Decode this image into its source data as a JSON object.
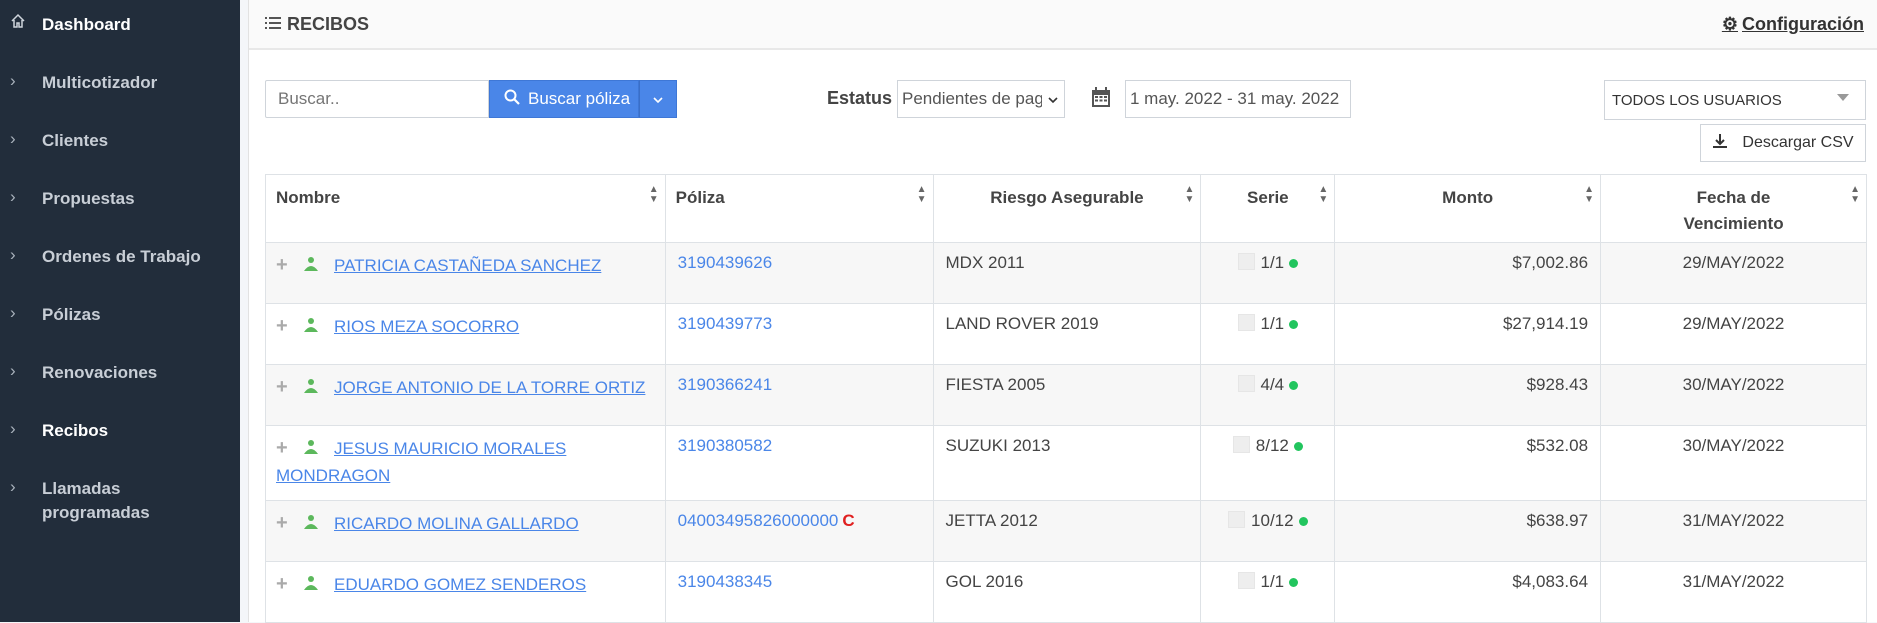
{
  "sidebar": {
    "items": [
      {
        "label": "Dashboard",
        "icon": "home-icon"
      },
      {
        "label": "Multicotizador",
        "icon": "chevron-right-icon"
      },
      {
        "label": "Clientes",
        "icon": "chevron-right-icon"
      },
      {
        "label": "Propuestas",
        "icon": "chevron-right-icon"
      },
      {
        "label": "Ordenes de Trabajo",
        "icon": "chevron-right-icon"
      },
      {
        "label": "Pólizas",
        "icon": "chevron-right-icon"
      },
      {
        "label": "Renovaciones",
        "icon": "chevron-right-icon"
      },
      {
        "label": "Recibos",
        "icon": "chevron-right-icon"
      },
      {
        "label": "Llamadas programadas",
        "icon": "chevron-right-icon"
      }
    ]
  },
  "header": {
    "title": "RECIBOS",
    "config_label": "Configuración"
  },
  "toolbar": {
    "search_placeholder": "Buscar..",
    "search_button": "Buscar póliza",
    "estatus_label": "Estatus",
    "estatus_value": "Pendientes de pago",
    "date_range": "1 may. 2022 - 31 may. 2022",
    "users_value": "TODOS LOS USUARIOS",
    "csv_button": "Descargar CSV"
  },
  "table": {
    "headers": {
      "nombre": "Nombre",
      "poliza": "Póliza",
      "riesgo": "Riesgo Asegurable",
      "serie": "Serie",
      "monto": "Monto",
      "fecha": "Fecha de Vencimiento"
    },
    "rows": [
      {
        "nombre": "PATRICIA CASTAÑEDA SANCHEZ",
        "poliza": "3190439626",
        "badge": "",
        "riesgo": "MDX 2011",
        "serie": "1/1",
        "monto": "$7,002.86",
        "fecha": "29/MAY/2022"
      },
      {
        "nombre": "RIOS MEZA SOCORRO",
        "poliza": "3190439773",
        "badge": "",
        "riesgo": "LAND ROVER 2019",
        "serie": "1/1",
        "monto": "$27,914.19",
        "fecha": "29/MAY/2022"
      },
      {
        "nombre": "JORGE ANTONIO DE LA TORRE ORTIZ",
        "poliza": "3190366241",
        "badge": "",
        "riesgo": "FIESTA 2005",
        "serie": "4/4",
        "monto": "$928.43",
        "fecha": "30/MAY/2022"
      },
      {
        "nombre": "JESUS MAURICIO MORALES MONDRAGON",
        "poliza": "3190380582",
        "badge": "",
        "riesgo": "SUZUKI 2013",
        "serie": "8/12",
        "monto": "$532.08",
        "fecha": "30/MAY/2022"
      },
      {
        "nombre": "RICARDO MOLINA GALLARDO",
        "poliza": "04003495826000000",
        "badge": "C",
        "riesgo": "JETTA 2012",
        "serie": "10/12",
        "monto": "$638.97",
        "fecha": "31/MAY/2022"
      },
      {
        "nombre": "EDUARDO GOMEZ SENDEROS",
        "poliza": "3190438345",
        "badge": "",
        "riesgo": "GOL 2016",
        "serie": "1/1",
        "monto": "$4,083.64",
        "fecha": "31/MAY/2022"
      }
    ]
  },
  "colors": {
    "sidebar_bg": "#222d3b",
    "accent": "#4a86e8",
    "status_dot": "#22c55e",
    "badge": "#e02020"
  }
}
